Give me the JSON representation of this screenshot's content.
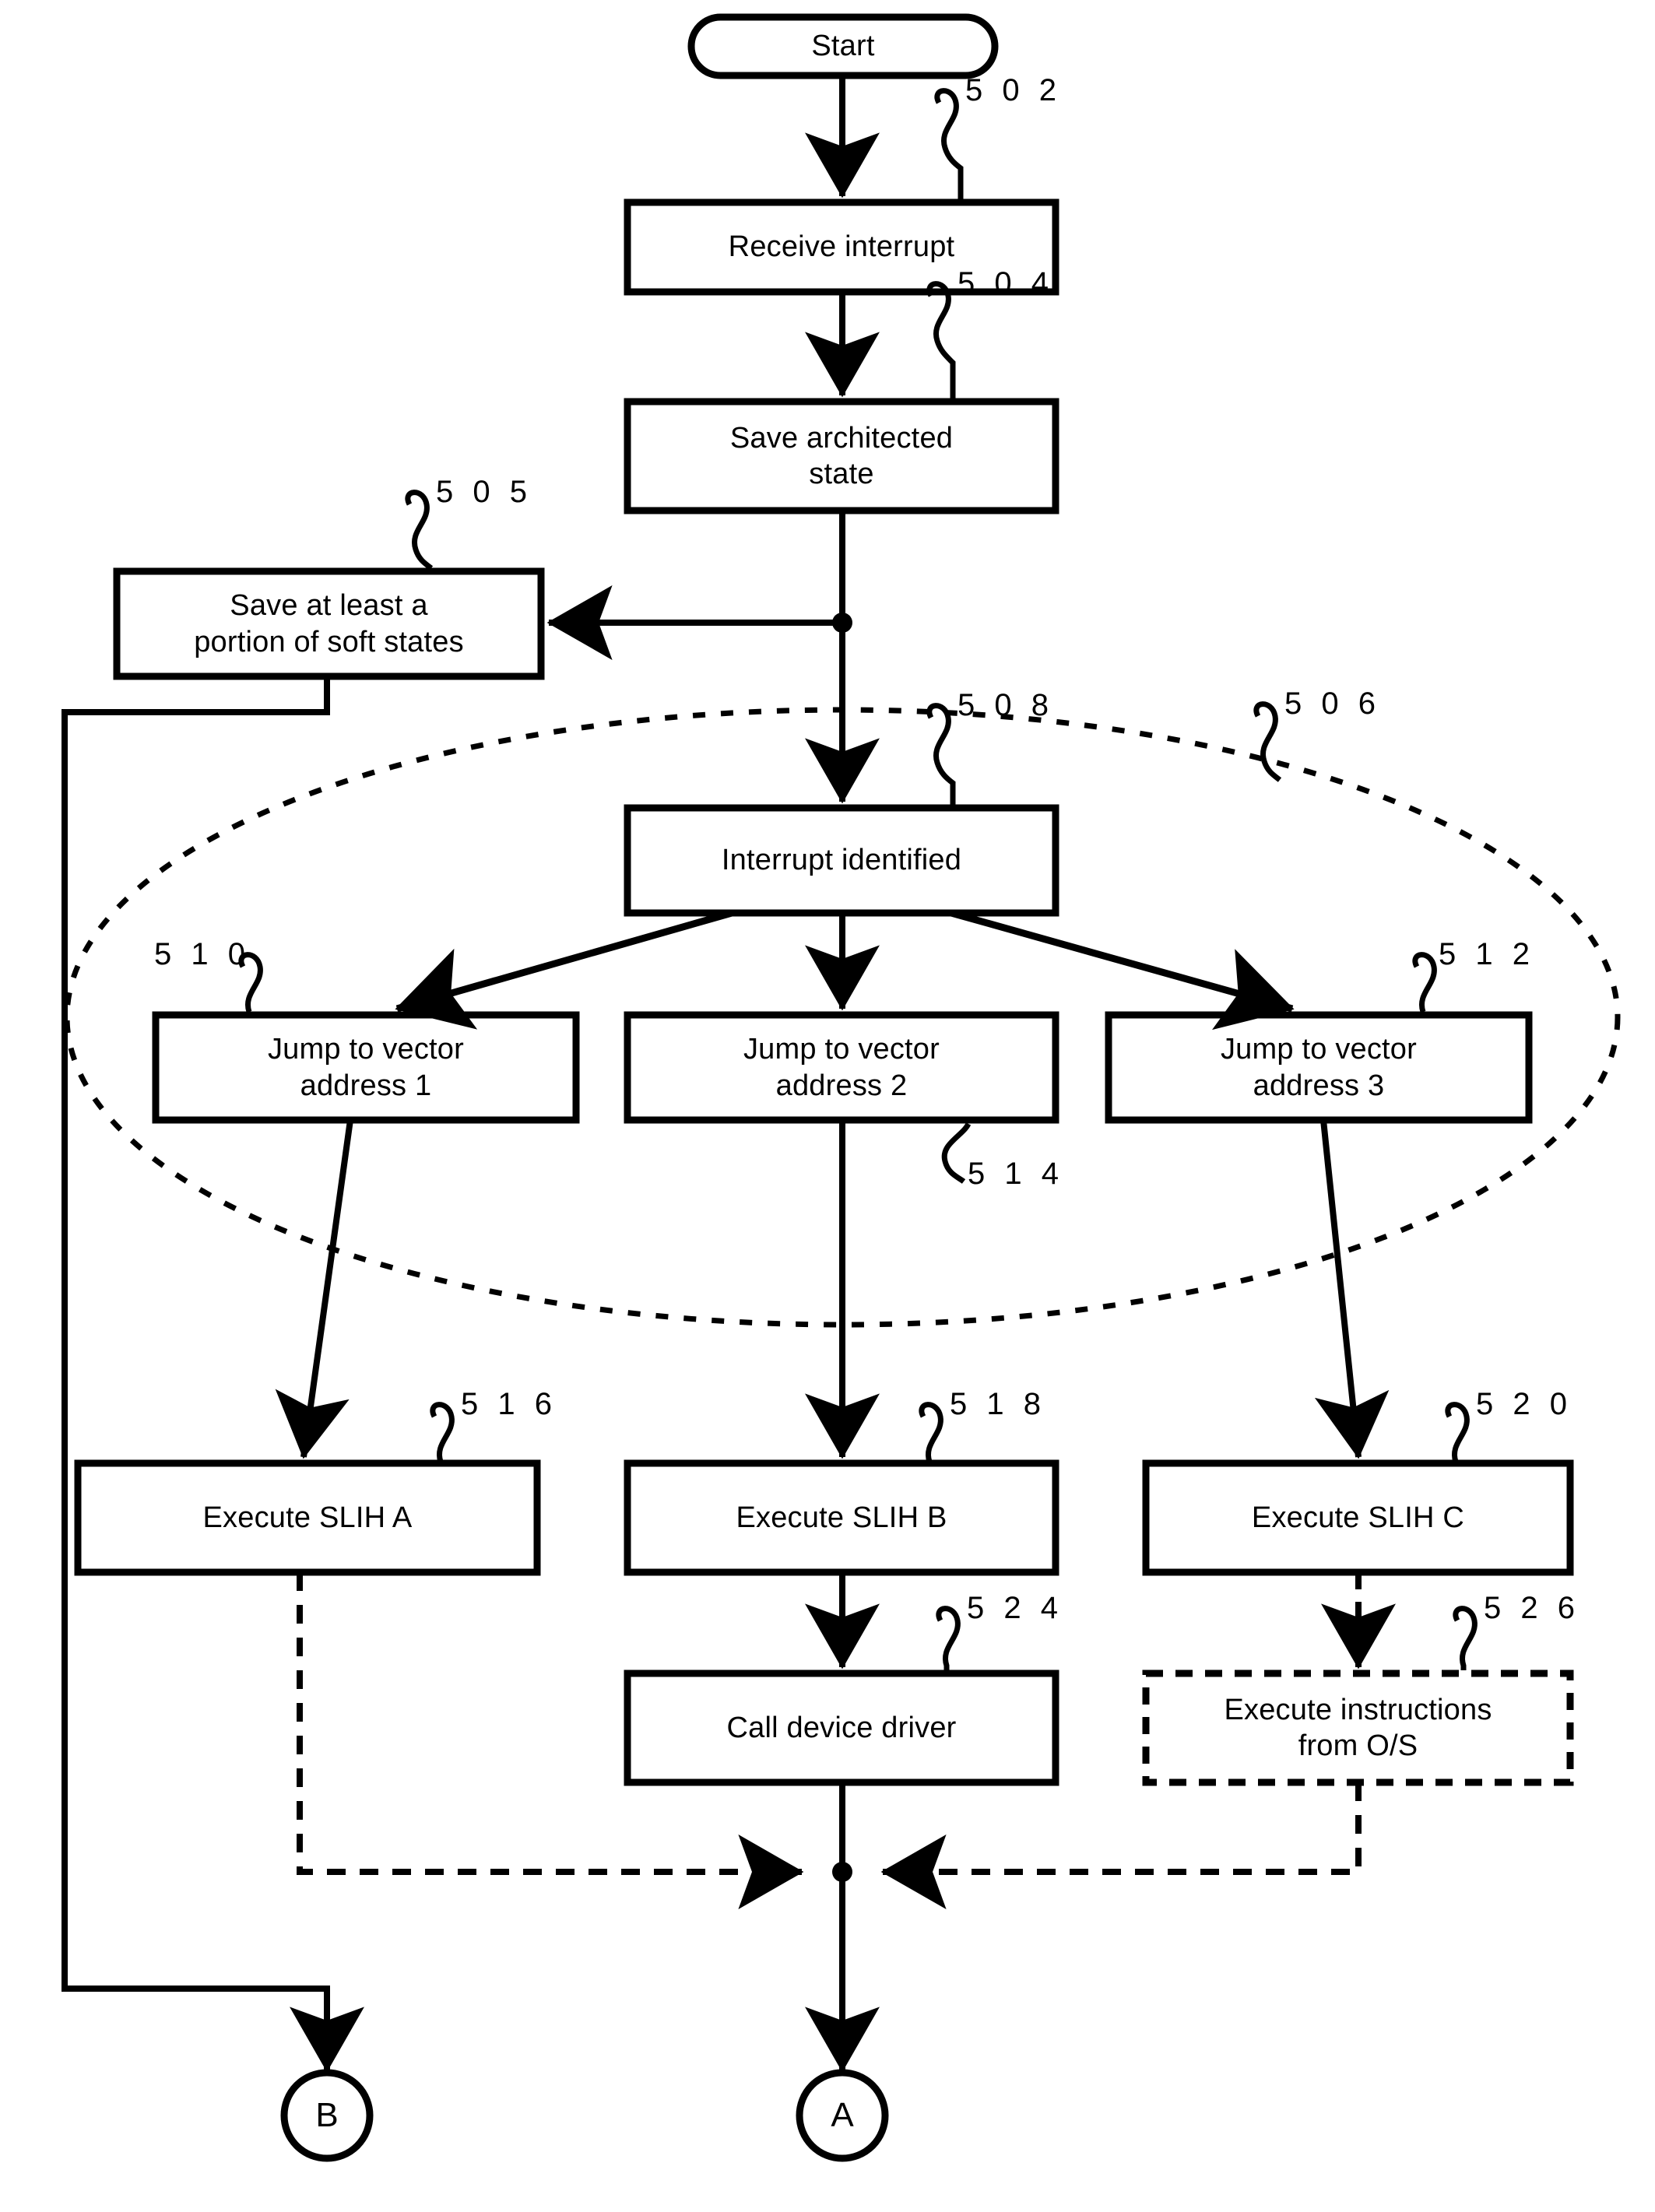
{
  "figure": {
    "nodes": {
      "start": {
        "label": "Start",
        "shape": "terminator"
      },
      "receive_interrupt": {
        "label": "Receive interrupt",
        "ref": "5 0 2",
        "shape": "process"
      },
      "save_architected_state": {
        "label": "Save architected\nstate",
        "ref": "5 0 4",
        "shape": "process"
      },
      "save_soft_states": {
        "label": "Save at least a\nportion of soft states",
        "ref": "5 0 5",
        "shape": "process"
      },
      "interrupt_identified": {
        "label": "Interrupt identified",
        "ref": "5 0 8",
        "shape": "process"
      },
      "jump_vector_1": {
        "label": "Jump to vector\naddress 1",
        "ref": "5 1 0",
        "shape": "process"
      },
      "jump_vector_2": {
        "label": "Jump to vector\naddress 2",
        "ref": "5 1 4",
        "shape": "process"
      },
      "jump_vector_3": {
        "label": "Jump to vector\naddress 3",
        "ref": "5 1 2",
        "shape": "process"
      },
      "execute_slih_a": {
        "label": "Execute SLIH A",
        "ref": "5 1 6",
        "shape": "process"
      },
      "execute_slih_b": {
        "label": "Execute SLIH B",
        "ref": "5 1 8",
        "shape": "process"
      },
      "execute_slih_c": {
        "label": "Execute SLIH C",
        "ref": "5 2 0",
        "shape": "process"
      },
      "call_device_driver": {
        "label": "Call device driver",
        "ref": "5 2 4",
        "shape": "process"
      },
      "execute_os_instructions": {
        "label": "Execute instructions\nfrom O/S",
        "ref": "5 2 6",
        "shape": "process-dashed"
      },
      "connector_a": {
        "label": "A",
        "shape": "connector"
      },
      "connector_b": {
        "label": "B",
        "shape": "connector"
      }
    },
    "grouping": {
      "flih_region": {
        "ref": "5 0 6",
        "shape": "dashed-ellipse"
      }
    },
    "colors": {
      "stroke": "#000000",
      "background": "#ffffff",
      "text": "#000000"
    }
  }
}
